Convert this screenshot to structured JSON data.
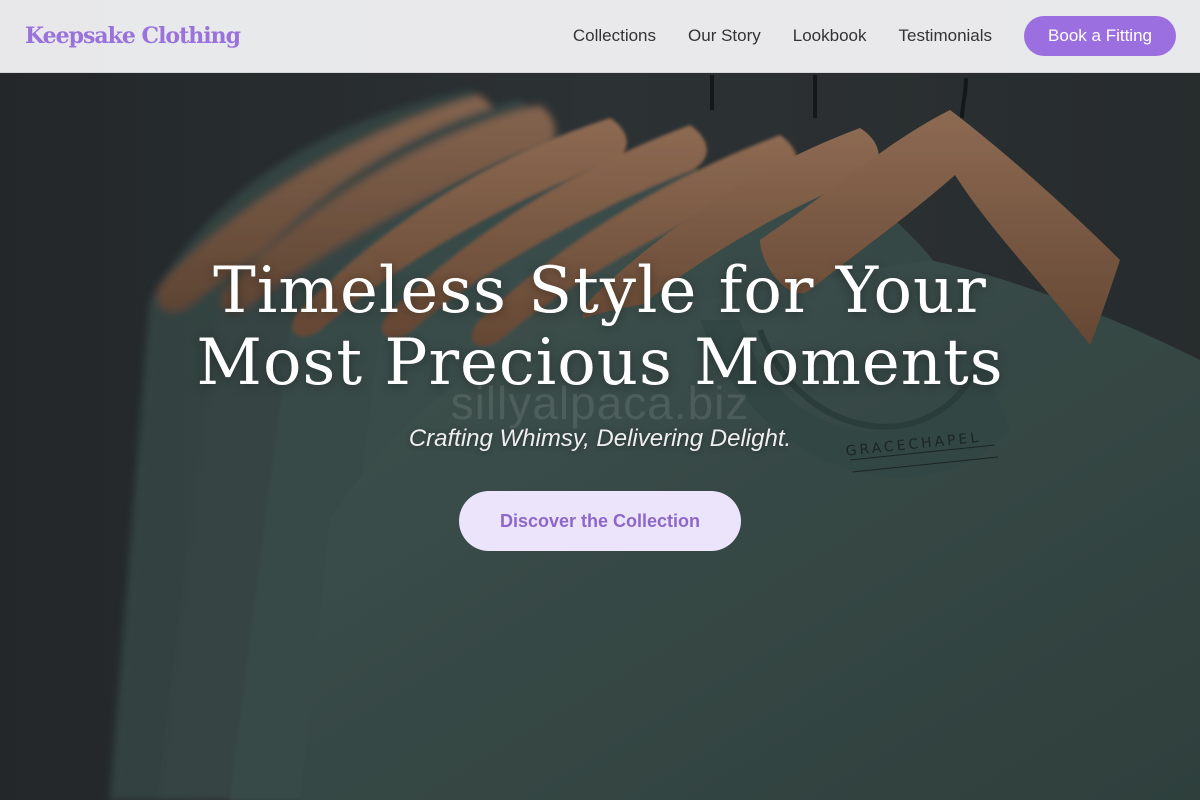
{
  "brand": {
    "name": "Keepsake Clothing",
    "accent": "#9b6fe0"
  },
  "nav": {
    "links": [
      "Collections",
      "Our Story",
      "Lookbook",
      "Testimonials"
    ],
    "cta_label": "Book a Fitting"
  },
  "hero": {
    "title_line1": "Timeless Style for Your",
    "title_line2": "Most Precious Moments",
    "subtitle": "Crafting Whimsy, Delivering Delight.",
    "button_label": "Discover the Collection",
    "shirt_tag_text": "GRACECHAPEL",
    "watermark": "sillyalpaca.biz",
    "colors": {
      "shirt": "#4f6760",
      "hanger": "#b07d57",
      "wall": "#3a3f41"
    }
  }
}
